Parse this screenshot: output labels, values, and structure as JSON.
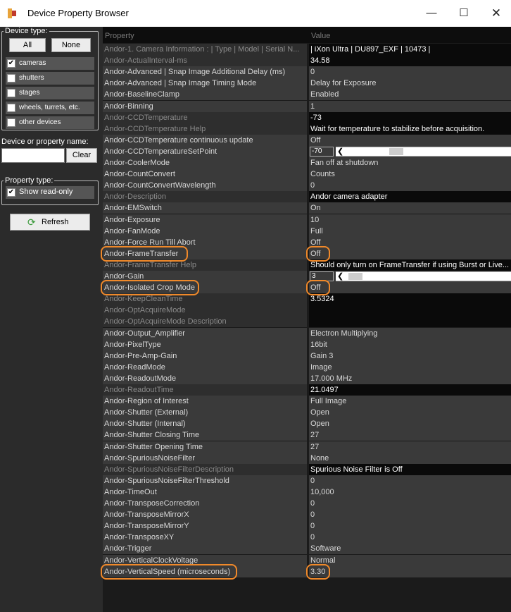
{
  "window": {
    "title": "Device Property Browser",
    "minimize_glyph": "—",
    "maximize_glyph": "☐",
    "close_glyph": "✕"
  },
  "left_panel": {
    "device_type": {
      "title": "Device type:",
      "all_label": "All",
      "none_label": "None",
      "checkboxes": [
        {
          "label": "cameras",
          "checked": true
        },
        {
          "label": "shutters",
          "checked": false
        },
        {
          "label": "stages",
          "checked": false
        },
        {
          "label": "wheels, turrets, etc.",
          "checked": false
        },
        {
          "label": "other devices",
          "checked": false
        }
      ]
    },
    "search": {
      "label": "Device or property name:",
      "value": "",
      "clear_label": "Clear"
    },
    "property_type": {
      "title": "Property type:",
      "show_read_only_label": "Show read-only",
      "show_read_only_checked": true
    },
    "refresh_label": "Refresh"
  },
  "grid": {
    "header": {
      "property": "Property",
      "value": "Value"
    },
    "rows": [
      {
        "name": "Andor-1. Camera Information : | Type | Model | Serial N...",
        "value": "| iXon Ultra | DU897_EXF | 10473 |",
        "ro": true
      },
      {
        "name": "Andor-ActualInterval-ms",
        "value": "34.58",
        "ro": true
      },
      {
        "name": "Andor-Advanced | Snap Image Additional Delay (ms)",
        "value": "0",
        "ro": false
      },
      {
        "name": "Andor-Advanced | Snap Image Timing Mode",
        "value": "Delay for Exposure",
        "ro": false
      },
      {
        "name": "Andor-BaselineClamp",
        "value": "Enabled",
        "ro": false
      },
      {
        "name": "Andor-Binning",
        "value": "1",
        "ro": false
      },
      {
        "name": "Andor-CCDTemperature",
        "value": "-73",
        "ro": true
      },
      {
        "name": "Andor-CCDTemperature Help",
        "value": "Wait for temperature to stabilize before acquisition.",
        "ro": true
      },
      {
        "name": "Andor-CCDTemperature continuous update",
        "value": "Off",
        "ro": false
      },
      {
        "name": "Andor-CCDTemperatureSetPoint",
        "value": "-70",
        "ro": false,
        "slider": 0.3
      },
      {
        "name": "Andor-CoolerMode",
        "value": "Fan off at shutdown",
        "ro": false
      },
      {
        "name": "Andor-CountConvert",
        "value": "Counts",
        "ro": false
      },
      {
        "name": "Andor-CountConvertWavelength",
        "value": "0",
        "ro": false
      },
      {
        "name": "Andor-Description",
        "value": "Andor camera adapter",
        "ro": true
      },
      {
        "name": "Andor-EMSwitch",
        "value": "On",
        "ro": false
      },
      {
        "name": "Andor-Exposure",
        "value": "10",
        "ro": false
      },
      {
        "name": "Andor-FanMode",
        "value": "Full",
        "ro": false
      },
      {
        "name": "Andor-Force Run Till Abort",
        "value": "Off",
        "ro": false
      },
      {
        "name": "Andor-FrameTransfer",
        "value": "Off",
        "ro": false
      },
      {
        "name": "Andor-FrameTransfer Help",
        "value": "Should only turn on FrameTransfer if using Burst or Live...",
        "ro": true
      },
      {
        "name": "Andor-Gain",
        "value": "3",
        "ro": false,
        "slider": 0.01
      },
      {
        "name": "Andor-Isolated Crop Mode",
        "value": "Off",
        "ro": false
      },
      {
        "name": "Andor-KeepCleanTime",
        "value": "3.5324",
        "ro": true
      },
      {
        "name": "Andor-OptAcquireMode",
        "value": "",
        "ro": true
      },
      {
        "name": "Andor-OptAcquireMode Description",
        "value": "",
        "ro": true
      },
      {
        "name": "Andor-Output_Amplifier",
        "value": "Electron Multiplying",
        "ro": false
      },
      {
        "name": "Andor-PixelType",
        "value": "16bit",
        "ro": false
      },
      {
        "name": "Andor-Pre-Amp-Gain",
        "value": "Gain 3",
        "ro": false
      },
      {
        "name": "Andor-ReadMode",
        "value": "Image",
        "ro": false
      },
      {
        "name": "Andor-ReadoutMode",
        "value": "17.000 MHz",
        "ro": false
      },
      {
        "name": "Andor-ReadoutTime",
        "value": "21.0497",
        "ro": true
      },
      {
        "name": "Andor-Region of Interest",
        "value": "Full Image",
        "ro": false
      },
      {
        "name": "Andor-Shutter (External)",
        "value": "Open",
        "ro": false
      },
      {
        "name": "Andor-Shutter (Internal)",
        "value": "Open",
        "ro": false
      },
      {
        "name": "Andor-Shutter Closing Time",
        "value": "27",
        "ro": false
      },
      {
        "name": "Andor-Shutter Opening Time",
        "value": "27",
        "ro": false
      },
      {
        "name": "Andor-SpuriousNoiseFilter",
        "value": "None",
        "ro": false
      },
      {
        "name": "Andor-SpuriousNoiseFilterDescription",
        "value": "Spurious Noise Filter is Off",
        "ro": true
      },
      {
        "name": "Andor-SpuriousNoiseFilterThreshold",
        "value": "0",
        "ro": false
      },
      {
        "name": "Andor-TimeOut",
        "value": "10,000",
        "ro": false
      },
      {
        "name": "Andor-TransposeCorrection",
        "value": "0",
        "ro": false
      },
      {
        "name": "Andor-TransposeMirrorX",
        "value": "0",
        "ro": false
      },
      {
        "name": "Andor-TransposeMirrorY",
        "value": "0",
        "ro": false
      },
      {
        "name": "Andor-TransposeXY",
        "value": "0",
        "ro": false
      },
      {
        "name": "Andor-Trigger",
        "value": "Software",
        "ro": false
      },
      {
        "name": "Andor-VerticalClockVoltage",
        "value": "Normal",
        "ro": false
      },
      {
        "name": "Andor-VerticalSpeed (microseconds)",
        "value": "3.30",
        "ro": false
      }
    ],
    "highlighted_rows": [
      18,
      21,
      46
    ]
  },
  "colors": {
    "highlight": "#f0892a"
  }
}
